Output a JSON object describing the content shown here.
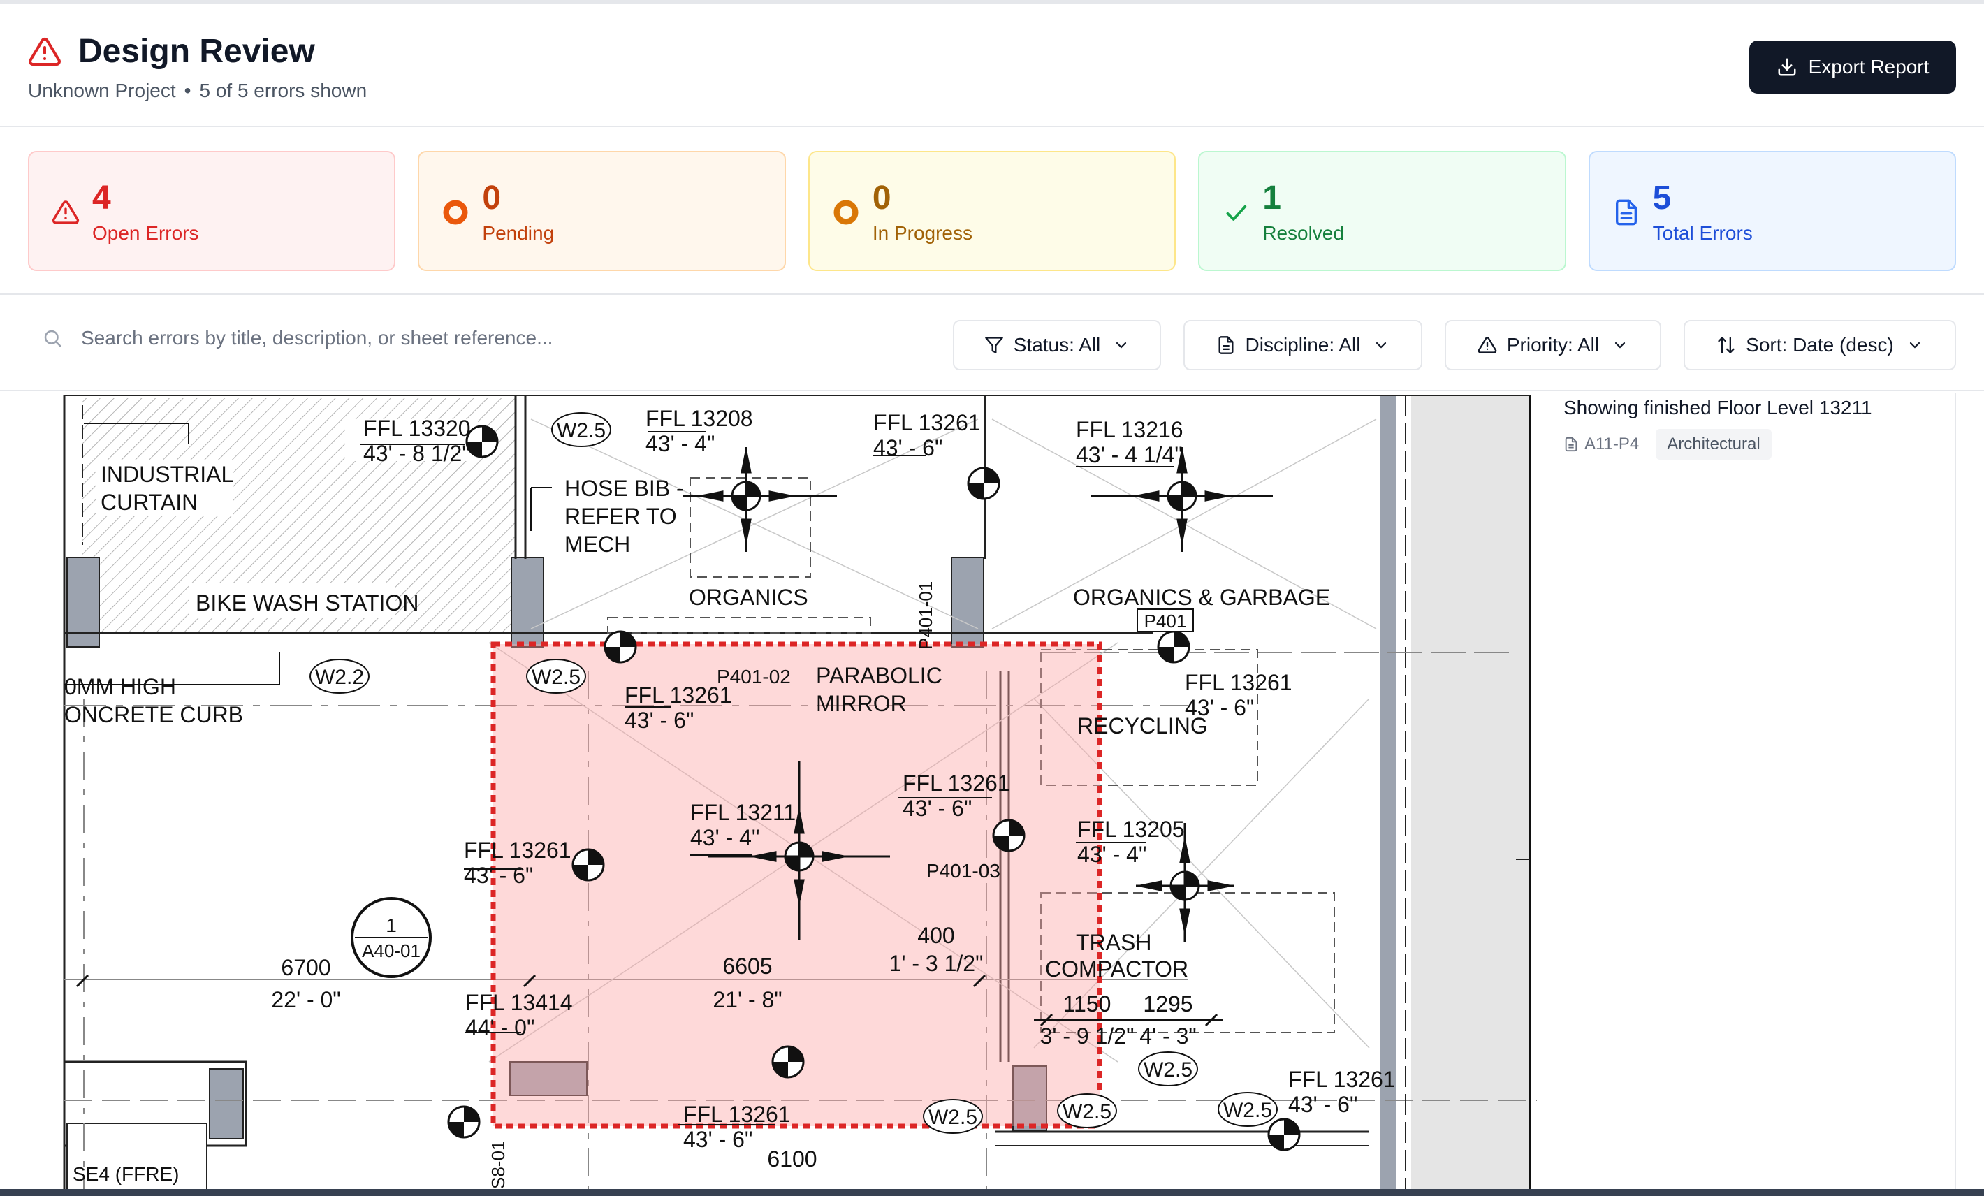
{
  "header": {
    "title": "Design Review",
    "project": "Unknown Project",
    "separator": "•",
    "count_text": "5 of 5 errors shown",
    "export_label": "Export Report"
  },
  "stats": [
    {
      "value": "4",
      "label": "Open Errors",
      "icon": "alert-triangle-icon"
    },
    {
      "value": "0",
      "label": "Pending",
      "icon": "circle-dot-icon"
    },
    {
      "value": "0",
      "label": "In Progress",
      "icon": "circle-dot-icon"
    },
    {
      "value": "1",
      "label": "Resolved",
      "icon": "check-icon"
    },
    {
      "value": "5",
      "label": "Total Errors",
      "icon": "file-text-icon"
    }
  ],
  "filters": {
    "search_placeholder": "Search errors by title, description, or sheet reference...",
    "status_label": "Status: All",
    "discipline_label": "Discipline: All",
    "priority_label": "Priority: All",
    "sort_label": "Sort: Date (desc)"
  },
  "error_item": {
    "title": "Showing finished Floor Level 13211",
    "sheet": "A11-P4",
    "discipline": "Architectural"
  },
  "drawing": {
    "labels": {
      "industrial_curtain_1": "INDUSTRIAL",
      "industrial_curtain_2": "CURTAIN",
      "bike_wash": "BIKE WASH STATION",
      "curb_1": "0MM HIGH",
      "curb_2": "ONCRETE CURB",
      "hose_1": "HOSE BIB -",
      "hose_2": "REFER TO",
      "hose_3": "MECH",
      "organics": "ORGANICS",
      "organics_garbage": "ORGANICS & GARBAGE",
      "p401": "P401",
      "parabolic_1": "PARABOLIC",
      "parabolic_2": "MIRROR",
      "recycling": "RECYCLING",
      "trash_1": "TRASH",
      "trash_2": "COMPACTOR",
      "p401_01": "P401-01",
      "p401_02": "P401-02",
      "p401_03": "P401-03",
      "se4": "SE4 (FFRE)",
      "detail_num": "1",
      "detail_ref": "A40-01",
      "s8_01": "S8-01"
    },
    "tags": {
      "w25": "W2.5",
      "w22": "W2.2"
    },
    "levels": {
      "ffl_13320": "FFL 13320",
      "ffl_13320_imp": "43' - 8 1/2\"",
      "ffl_13208": "FFL 13208",
      "ffl_13208_imp": "43' - 4\"",
      "ffl_13261": "FFL 13261",
      "ffl_13261_imp": "43' - 6\"",
      "ffl_13216": "FFL 13216",
      "ffl_13216_imp": "43' - 4 1/4\"",
      "ffl_13211": "FFL 13211",
      "ffl_13211_imp": "43' - 4\"",
      "ffl_13205": "FFL 13205",
      "ffl_13205_imp": "43' - 4\"",
      "ffl_13414": "FFL 13414",
      "ffl_13414_imp": "44' - 0\""
    },
    "dims": {
      "d6700": "6700",
      "d6700_imp": "22' - 0\"",
      "d6605": "6605",
      "d6605_imp": "21' - 8\"",
      "d400": "400",
      "d400_imp": "1' - 3 1/2\"",
      "d1150": "1150",
      "d1150_imp": "3' - 9 1/2\"",
      "d1295": "1295",
      "d1295_imp": "4' - 3\"",
      "d6100": "6100"
    }
  },
  "colors": {
    "primary_dark": "#111827",
    "open_red": "#dc2626",
    "pending_orange": "#ea580c",
    "progress_amber": "#d97706",
    "resolved_green": "#16a34a",
    "total_blue": "#2563eb",
    "highlight_fill": "#fecaca",
    "highlight_border": "#e11d48"
  }
}
